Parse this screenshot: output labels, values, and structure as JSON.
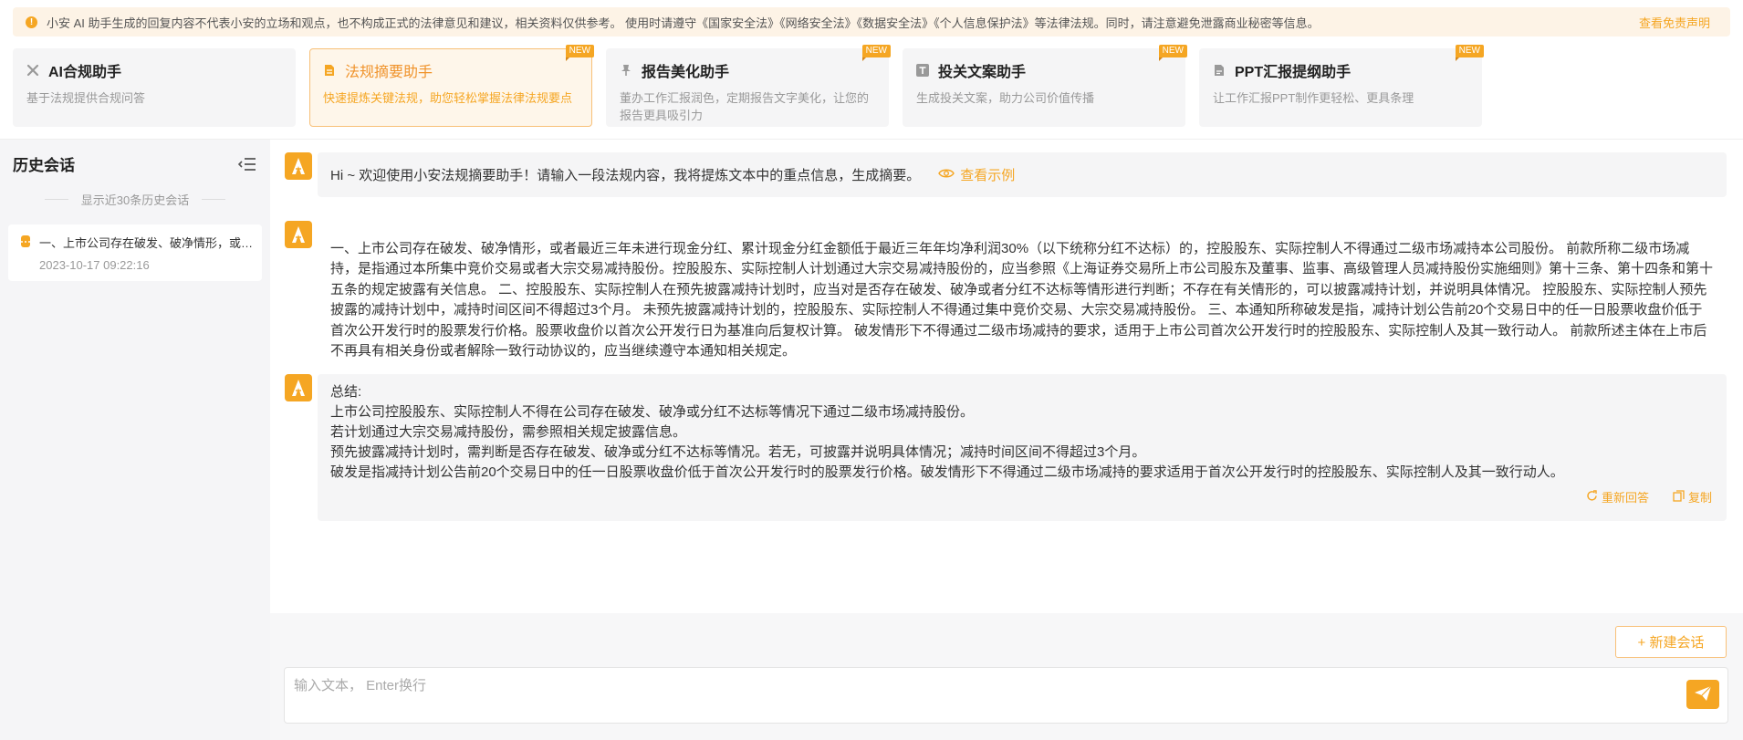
{
  "notice": {
    "text": "小安 AI 助手生成的回复内容不代表小安的立场和观点，也不构成正式的法律意见和建议，相关资料仅供参考。 使用时请遵守《国家安全法》《网络安全法》《数据安全法》《个人信息保护法》等法律法规。同时，请注意避免泄露商业秘密等信息。",
    "link": "查看免责声明"
  },
  "tools": [
    {
      "title": "AI合规助手",
      "desc": "基于法规提供合规问答",
      "new": ""
    },
    {
      "title": "法规摘要助手",
      "desc": "快速提炼关键法规，助您轻松掌握法律法规要点",
      "new": "NEW"
    },
    {
      "title": "报告美化助手",
      "desc": "董办工作汇报润色，定期报告文字美化，让您的报告更具吸引力",
      "new": "NEW"
    },
    {
      "title": "投关文案助手",
      "desc": "生成投关文案，助力公司价值传播",
      "new": "NEW"
    },
    {
      "title": "PPT汇报提纲助手",
      "desc": "让工作汇报PPT制作更轻松、更具条理",
      "new": "NEW"
    }
  ],
  "sidebar": {
    "title": "历史会话",
    "subtitle": "显示近30条历史会话",
    "items": [
      {
        "title": "一、上市公司存在破发、破净情形，或者最近三年未进行现金分红",
        "time": "2023-10-17 09:22:16"
      }
    ]
  },
  "chat": {
    "welcome": "Hi ~ 欢迎使用小安法规摘要助手！请输入一段法规内容，我将提炼文本中的重点信息，生成摘要。",
    "view_example": "查看示例",
    "user_message": "一、上市公司存在破发、破净情形，或者最近三年未进行现金分红、累计现金分红金额低于最近三年年均净利润30%（以下统称分红不达标）的，控股股东、实际控制人不得通过二级市场减持本公司股份。 前款所称二级市场减持，是指通过本所集中竞价交易或者大宗交易减持股份。控股股东、实际控制人计划通过大宗交易减持股份的，应当参照《上海证券交易所上市公司股东及董事、监事、高级管理人员减持股份实施细则》第十三条、第十四条和第十五条的规定披露有关信息。 二、控股股东、实际控制人在预先披露减持计划时，应当对是否存在破发、破净或者分红不达标等情形进行判断；不存在有关情形的，可以披露减持计划，并说明具体情况。 控股股东、实际控制人预先披露的减持计划中，减持时间区间不得超过3个月。 未预先披露减持计划的，控股股东、实际控制人不得通过集中竞价交易、大宗交易减持股份。 三、本通知所称破发是指，减持计划公告前20个交易日中的任一日股票收盘价低于首次公开发行时的股票发行价格。股票收盘价以首次公开发行日为基准向后复权计算。 破发情形下不得通过二级市场减持的要求，适用于上市公司首次公开发行时的控股股东、实际控制人及其一致行动人。 前款所述主体在上市后不再具有相关身份或者解除一致行动协议的，应当继续遵守本通知相关规定。",
    "answer_lines": [
      "总结:",
      "上市公司控股股东、实际控制人不得在公司存在破发、破净或分红不达标等情况下通过二级市场减持股份。",
      "若计划通过大宗交易减持股份，需参照相关规定披露信息。",
      "预先披露减持计划时，需判断是否存在破发、破净或分红不达标等情况。若无，可披露并说明具体情况；减持时间区间不得超过3个月。",
      "破发是指减持计划公告前20个交易日中的任一日股票收盘价低于首次公开发行时的股票发行价格。破发情形下不得通过二级市场减持的要求适用于首次公开发行时的控股股东、实际控制人及其一致行动人。"
    ],
    "regenerate": "重新回答",
    "copy": "复制"
  },
  "input": {
    "placeholder": "输入文本， Enter换行",
    "new_chat": "+ 新建会话"
  },
  "colors": {
    "accent": "#f5a623"
  }
}
